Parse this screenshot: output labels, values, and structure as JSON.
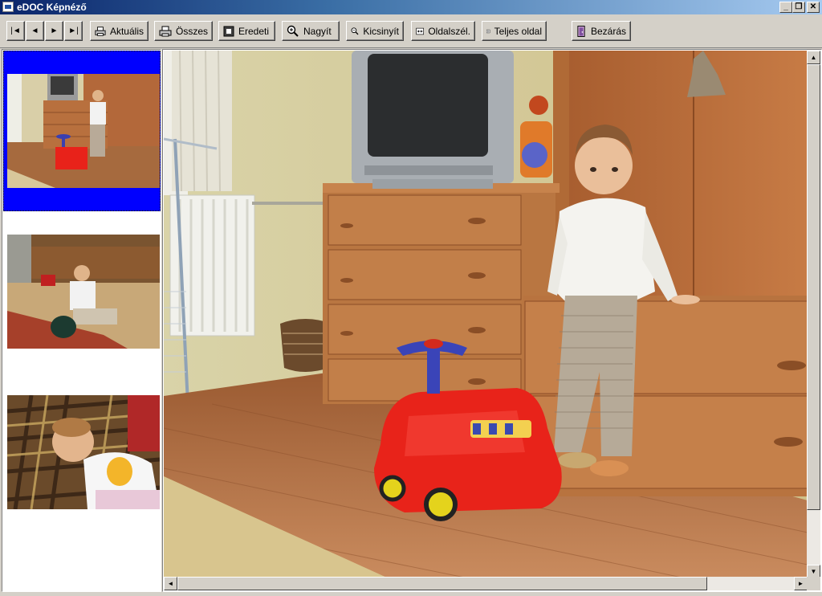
{
  "window": {
    "title": "eDOC Képnéző",
    "minimize_glyph": "_",
    "restore_glyph": "❐",
    "close_glyph": "✕"
  },
  "toolbar": {
    "first_glyph": "|◄",
    "prev_glyph": "◄",
    "next_glyph": "►",
    "last_glyph": "►|",
    "aktualis_label": "Aktuális",
    "osszes_label": "Összes",
    "eredeti_label": "Eredeti",
    "nagyit_label": "Nagyít",
    "kicsinyit_label": "Kicsinyít",
    "oldalszel_label": "Oldalszél.",
    "teljes_label": "Teljes oldal",
    "bezaras_label": "Bezárás",
    "icons": {
      "aktualis": "printer-icon",
      "osszes": "printer-icon",
      "eredeti": "original-size-icon",
      "nagyit": "zoom-in-icon",
      "kicsinyit": "zoom-out-icon",
      "oldalszel": "fit-width-icon",
      "teljes": "full-page-icon",
      "bezaras": "exit-door-icon"
    }
  },
  "thumbnails": {
    "selected_index": 0,
    "selection_color": "#0000ff",
    "items": [
      {
        "subject": "toddler standing by dresser with red toy car"
      },
      {
        "subject": "toddler sitting on floor with green pot"
      },
      {
        "subject": "baby lying on plaid cushion in yellow shirt"
      }
    ]
  }
}
